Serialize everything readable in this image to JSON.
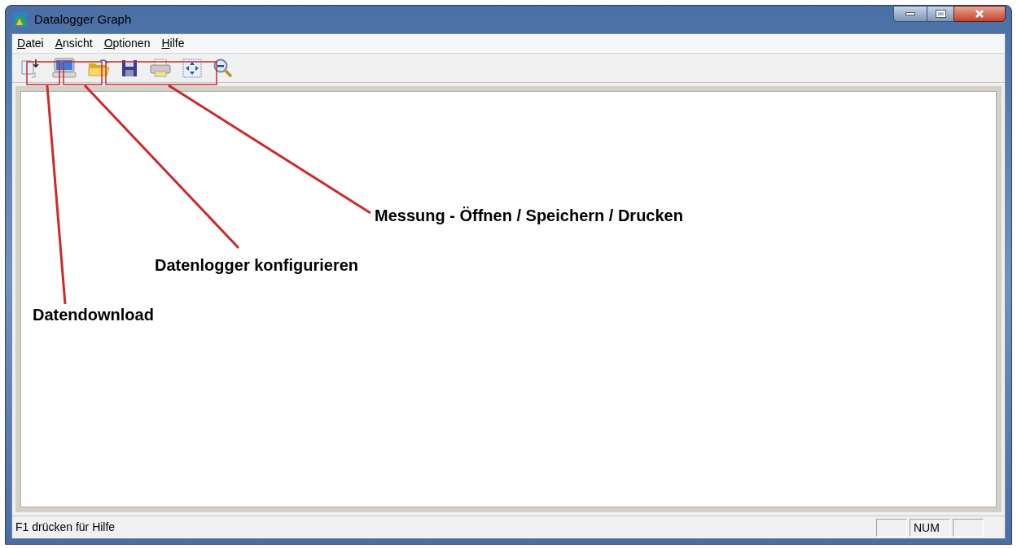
{
  "window": {
    "title": "Datalogger Graph"
  },
  "menu": [
    "Datei",
    "Ansicht",
    "Optionen",
    "Hilfe"
  ],
  "annotations": [
    {
      "label": "Messung - Öffnen / Speichern / Drucken"
    },
    {
      "label": "Datenlogger konfigurieren"
    },
    {
      "label": "Datendownload"
    }
  ],
  "status_bar": {
    "text": "F1 drücken für Hilfe",
    "indicator": "NUM"
  }
}
